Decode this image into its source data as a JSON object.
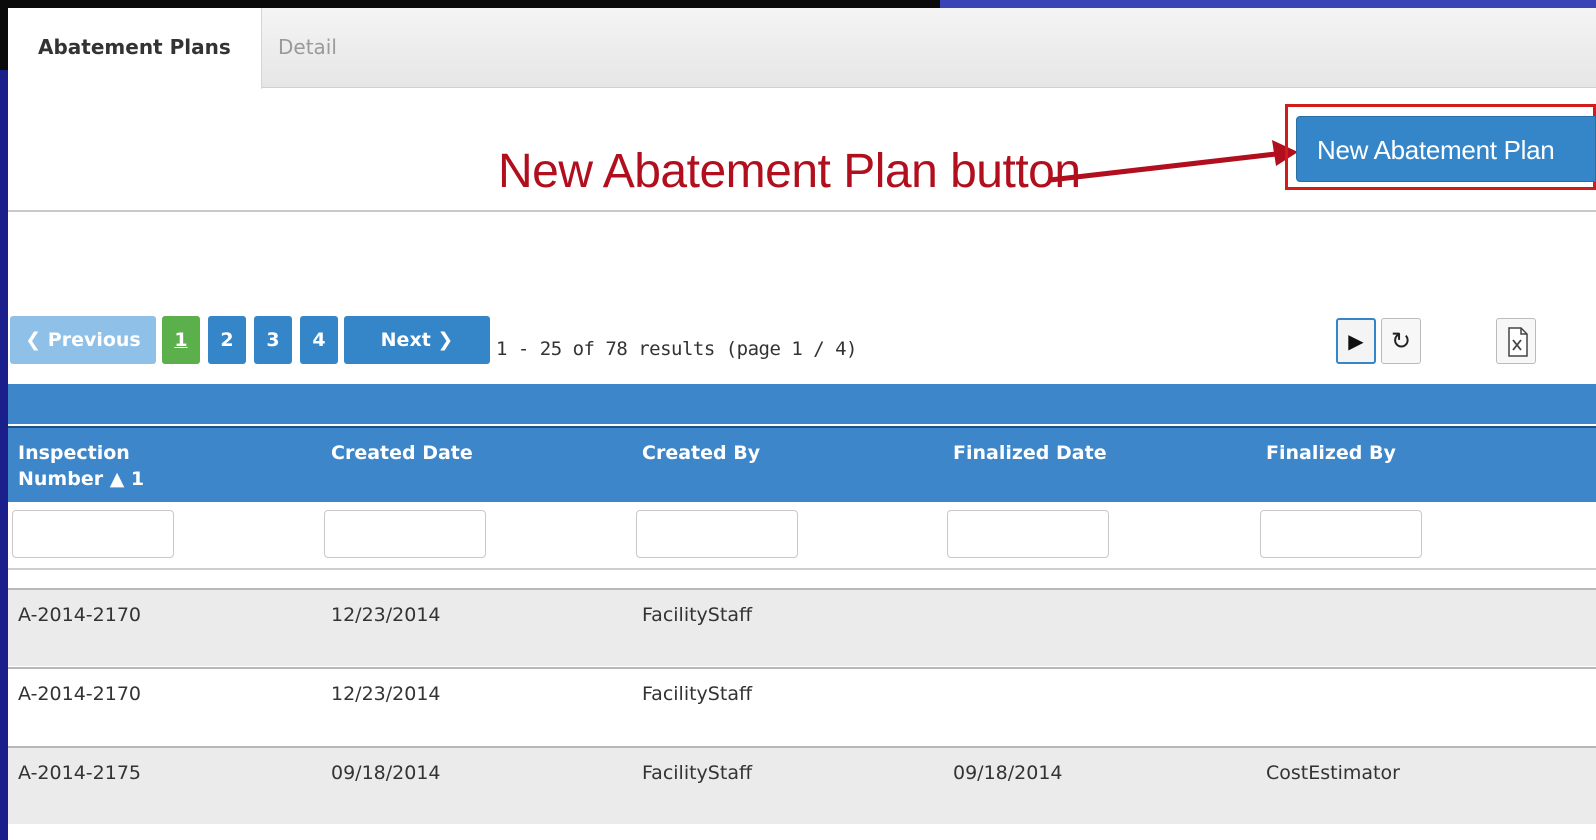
{
  "tabs": [
    {
      "label": "Abatement Plans"
    },
    {
      "label": "Detail"
    }
  ],
  "callout": {
    "text": "New Abatement Plan button"
  },
  "actions": {
    "new_plan_label": "New Abatement Plan"
  },
  "pagination": {
    "previous": "❮ Previous",
    "pages": [
      "1",
      "2",
      "3",
      "4"
    ],
    "current_page": "1",
    "next": "Next ❯",
    "summary": "1 -  25 of  78 results (page  1 /  4)"
  },
  "toolbar": {
    "play_icon": "▶",
    "refresh_icon": "↻"
  },
  "table": {
    "columns": [
      {
        "label": "Inspection Number ▲ 1"
      },
      {
        "label": "Created Date"
      },
      {
        "label": "Created By"
      },
      {
        "label": "Finalized Date"
      },
      {
        "label": "Finalized By"
      }
    ],
    "rows": [
      {
        "inspection": "A-2014-2170",
        "created_date": "12/23/2014",
        "created_by": "FacilityStaff",
        "finalized_date": "",
        "finalized_by": ""
      },
      {
        "inspection": "A-2014-2170",
        "created_date": "12/23/2014",
        "created_by": "FacilityStaff",
        "finalized_date": "",
        "finalized_by": ""
      },
      {
        "inspection": "A-2014-2175",
        "created_date": "09/18/2014",
        "created_by": "FacilityStaff",
        "finalized_date": "09/18/2014",
        "finalized_by": "CostEstimator"
      }
    ]
  },
  "colors": {
    "accent": "#3486c9",
    "callout": "#b10f1e",
    "current_page": "#5cb04c"
  }
}
